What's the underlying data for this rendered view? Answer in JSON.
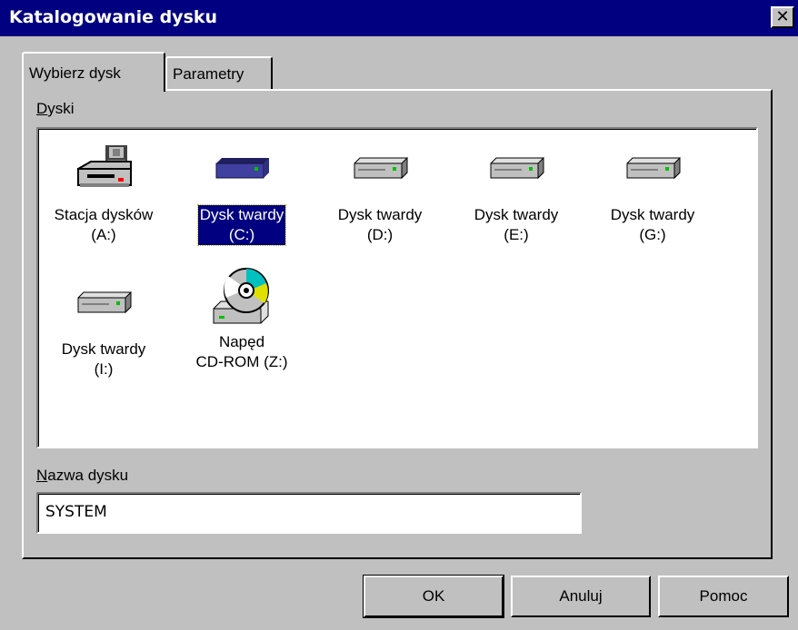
{
  "window": {
    "title": "Katalogowanie dysku",
    "close_label": "✕"
  },
  "tabs": [
    {
      "label": "Wybierz dysk",
      "active": true
    },
    {
      "label": "Parametry",
      "active": false
    }
  ],
  "drives_label": "Dyski",
  "drives": [
    {
      "line1": "Stacja dysków",
      "line2": "(A:)",
      "icon": "floppy-drive-icon"
    },
    {
      "line1": "Dysk twardy",
      "line2": "(C:)",
      "icon": "hard-disk-icon",
      "selected": true
    },
    {
      "line1": "Dysk twardy",
      "line2": "(D:)",
      "icon": "hard-disk-icon"
    },
    {
      "line1": "Dysk twardy",
      "line2": "(E:)",
      "icon": "hard-disk-icon"
    },
    {
      "line1": "Dysk twardy",
      "line2": "(G:)",
      "icon": "hard-disk-icon"
    },
    {
      "line1": "Dysk twardy",
      "line2": "(I:)",
      "icon": "hard-disk-icon"
    },
    {
      "line1": "Napęd",
      "line2": "CD-ROM (Z:)",
      "icon": "cd-rom-icon"
    }
  ],
  "disk_name_label": "Nazwa dysku",
  "disk_name_value": "SYSTEM",
  "buttons": {
    "ok": "OK",
    "cancel": "Anuluj",
    "help": "Pomoc"
  },
  "colors": {
    "titlebar": "#000080",
    "face": "#c0c0c0",
    "selection": "#000080"
  }
}
